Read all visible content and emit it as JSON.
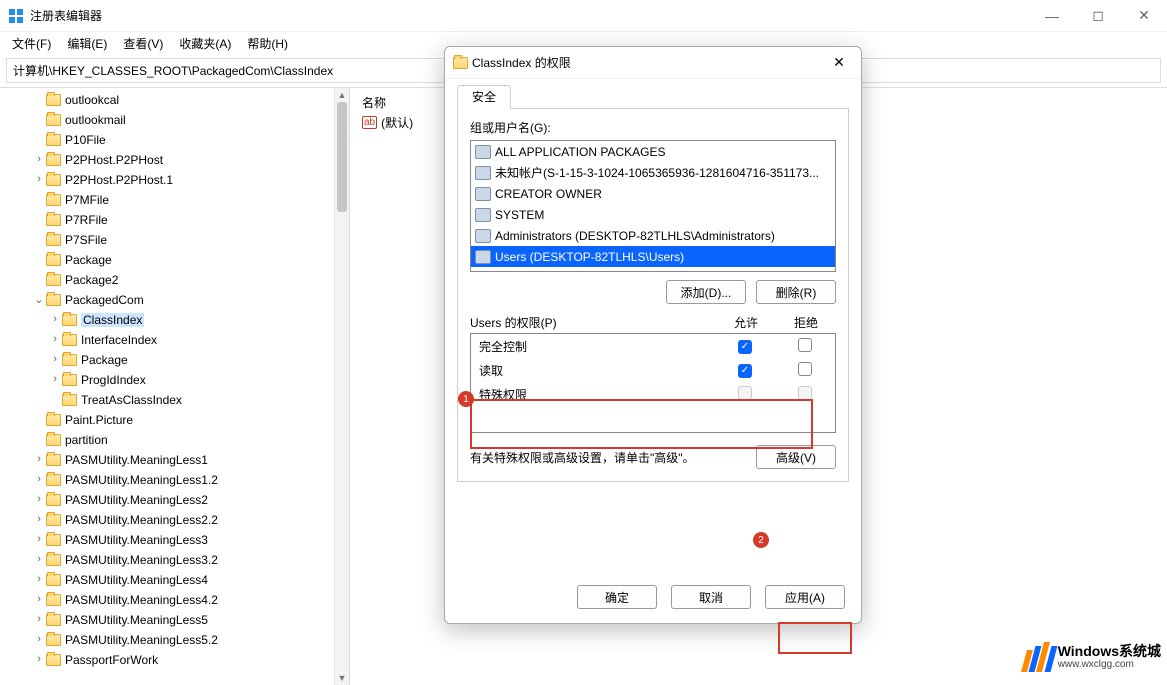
{
  "window": {
    "title": "注册表编辑器",
    "minimize": "—",
    "maximize": "◻",
    "close": "✕"
  },
  "menu": {
    "file": "文件(F)",
    "edit": "编辑(E)",
    "view": "查看(V)",
    "favorites": "收藏夹(A)",
    "help": "帮助(H)"
  },
  "address": "计算机\\HKEY_CLASSES_ROOT\\PackagedCom\\ClassIndex",
  "right": {
    "col_name": "名称",
    "default_row": "(默认)"
  },
  "tree": [
    {
      "indent": 2,
      "exp": "",
      "label": "outlookcal"
    },
    {
      "indent": 2,
      "exp": "",
      "label": "outlookmail"
    },
    {
      "indent": 2,
      "exp": "",
      "label": "P10File"
    },
    {
      "indent": 2,
      "exp": ">",
      "label": "P2PHost.P2PHost"
    },
    {
      "indent": 2,
      "exp": ">",
      "label": "P2PHost.P2PHost.1"
    },
    {
      "indent": 2,
      "exp": "",
      "label": "P7MFile"
    },
    {
      "indent": 2,
      "exp": "",
      "label": "P7RFile"
    },
    {
      "indent": 2,
      "exp": "",
      "label": "P7SFile"
    },
    {
      "indent": 2,
      "exp": "",
      "label": "Package"
    },
    {
      "indent": 2,
      "exp": "",
      "label": "Package2"
    },
    {
      "indent": 2,
      "exp": "v",
      "label": "PackagedCom"
    },
    {
      "indent": 3,
      "exp": ">",
      "label": "ClassIndex",
      "sel": true
    },
    {
      "indent": 3,
      "exp": ">",
      "label": "InterfaceIndex"
    },
    {
      "indent": 3,
      "exp": ">",
      "label": "Package"
    },
    {
      "indent": 3,
      "exp": ">",
      "label": "ProgIdIndex"
    },
    {
      "indent": 3,
      "exp": "",
      "label": "TreatAsClassIndex"
    },
    {
      "indent": 2,
      "exp": "",
      "label": "Paint.Picture"
    },
    {
      "indent": 2,
      "exp": "",
      "label": "partition"
    },
    {
      "indent": 2,
      "exp": ">",
      "label": "PASMUtility.MeaningLess1"
    },
    {
      "indent": 2,
      "exp": ">",
      "label": "PASMUtility.MeaningLess1.2"
    },
    {
      "indent": 2,
      "exp": ">",
      "label": "PASMUtility.MeaningLess2"
    },
    {
      "indent": 2,
      "exp": ">",
      "label": "PASMUtility.MeaningLess2.2"
    },
    {
      "indent": 2,
      "exp": ">",
      "label": "PASMUtility.MeaningLess3"
    },
    {
      "indent": 2,
      "exp": ">",
      "label": "PASMUtility.MeaningLess3.2"
    },
    {
      "indent": 2,
      "exp": ">",
      "label": "PASMUtility.MeaningLess4"
    },
    {
      "indent": 2,
      "exp": ">",
      "label": "PASMUtility.MeaningLess4.2"
    },
    {
      "indent": 2,
      "exp": ">",
      "label": "PASMUtility.MeaningLess5"
    },
    {
      "indent": 2,
      "exp": ">",
      "label": "PASMUtility.MeaningLess5.2"
    },
    {
      "indent": 2,
      "exp": ">",
      "label": "PassportForWork"
    }
  ],
  "dialog": {
    "title": "ClassIndex 的权限",
    "close": "✕",
    "tab_security": "安全",
    "group_label": "组或用户名(G):",
    "groups": [
      "ALL APPLICATION PACKAGES",
      "未知帐户(S-1-15-3-1024-1065365936-1281604716-351173...",
      "CREATOR OWNER",
      "SYSTEM",
      "Administrators (DESKTOP-82TLHLS\\Administrators)",
      "Users (DESKTOP-82TLHLS\\Users)"
    ],
    "selected_group_index": 5,
    "btn_add": "添加(D)...",
    "btn_remove": "删除(R)",
    "perm_label": "Users 的权限(P)",
    "col_allow": "允许",
    "col_deny": "拒绝",
    "perms": [
      {
        "name": "完全控制",
        "allow": true,
        "deny": false
      },
      {
        "name": "读取",
        "allow": true,
        "deny": false
      },
      {
        "name": "特殊权限",
        "allow": "dis",
        "deny": "dis"
      }
    ],
    "advanced_hint": "有关特殊权限或高级设置，请单击\"高级\"。",
    "btn_advanced": "高级(V)",
    "btn_ok": "确定",
    "btn_cancel": "取消",
    "btn_apply": "应用(A)"
  },
  "annotations": {
    "n1": "1",
    "n2": "2"
  },
  "watermark": {
    "line1": "Windows系统城",
    "line2": "www.wxclgg.com"
  }
}
